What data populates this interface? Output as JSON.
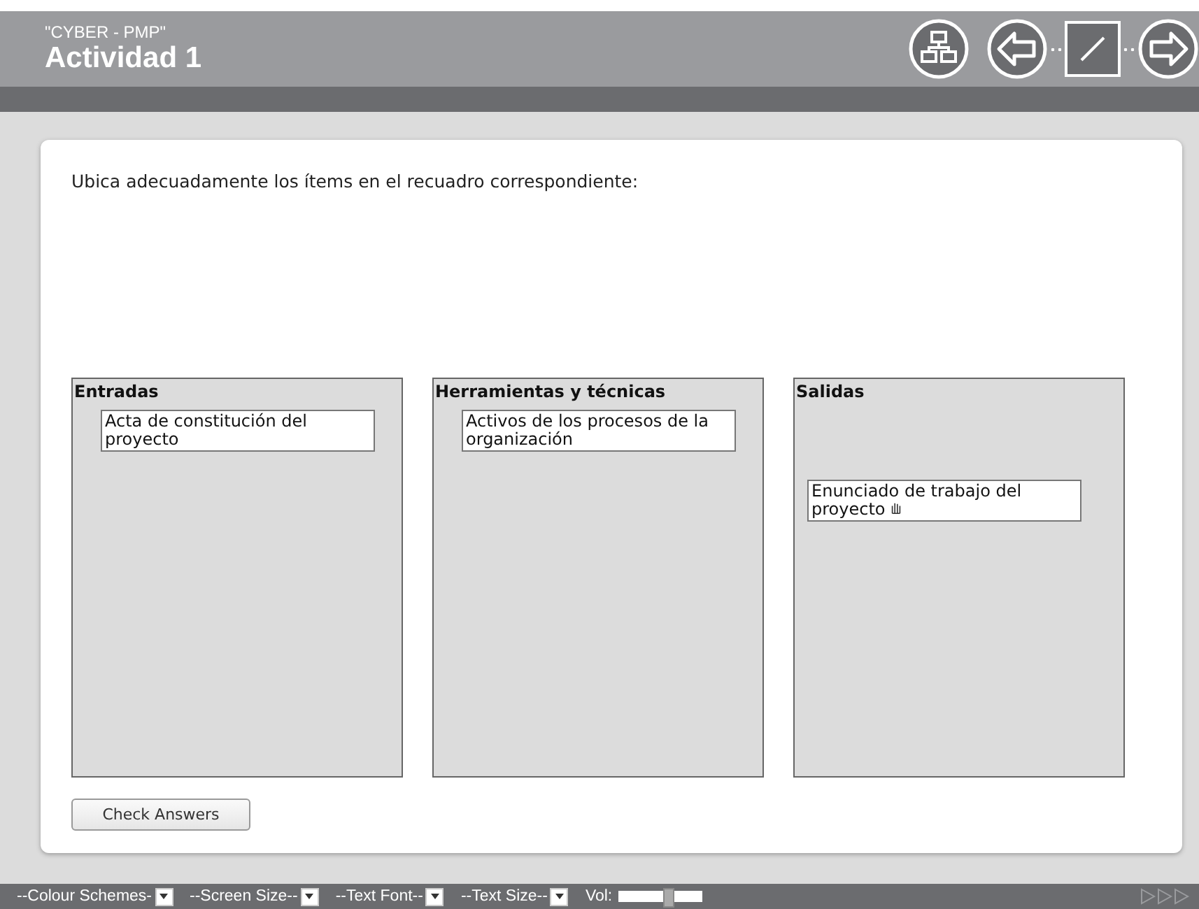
{
  "header": {
    "subtitle": "\"CYBER - PMP\"",
    "title": "Actividad 1"
  },
  "instruction": "Ubica adecuadamente los ítems en el recuadro correspondiente:",
  "zones": [
    {
      "title": "Entradas",
      "items": [
        "Acta de constitución del proyecto"
      ]
    },
    {
      "title": "Herramientas y técnicas",
      "items": [
        "Activos de los procesos de la organización"
      ]
    },
    {
      "title": "Salidas",
      "items": [
        "Enunciado de trabajo del proyecto"
      ]
    }
  ],
  "check_button": "Check Answers",
  "footer": {
    "menus": [
      "--Colour Schemes-",
      "--Screen Size--",
      "--Text Font--",
      "--Text Size--"
    ],
    "volume_label": "Vol:",
    "volume": {
      "level": 0.6
    }
  }
}
